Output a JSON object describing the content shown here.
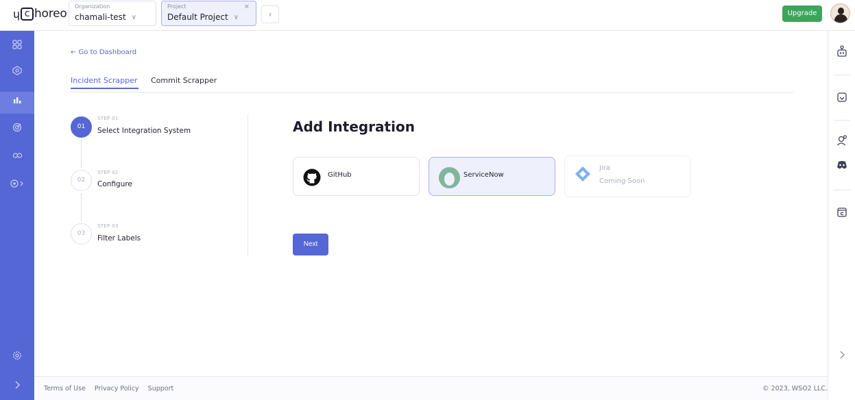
{
  "header": {
    "logo_prefix": "ɥ",
    "logo_c": "c",
    "logo_text": "horeo",
    "organization": {
      "label": "Organization",
      "value": "chamali-test"
    },
    "project": {
      "label": "Project",
      "value": "Default Project"
    },
    "upgrade_label": "Upgrade"
  },
  "sidebar": {
    "items": [
      {
        "icon": "grid-icon",
        "glyph": "⊞"
      },
      {
        "icon": "component-icon",
        "glyph": "⬡"
      },
      {
        "icon": "insights-icon",
        "glyph": "▮▮",
        "active": true
      },
      {
        "icon": "observability-icon",
        "glyph": "◎"
      },
      {
        "icon": "dependencies-icon",
        "glyph": "∞"
      },
      {
        "icon": "platform-icon",
        "glyph": "⊕›"
      },
      {
        "icon": "settings-icon",
        "glyph": "⚙"
      },
      {
        "icon": "expand-icon",
        "glyph": "›"
      }
    ]
  },
  "main": {
    "back_link": "← Go to Dashboard",
    "tabs": [
      {
        "label": "Incident Scrapper",
        "active": true
      },
      {
        "label": "Commit Scrapper",
        "active": false
      }
    ],
    "steps": [
      {
        "number": "01",
        "sub": "STEP 01",
        "title": "Select Integration System",
        "active": true
      },
      {
        "number": "02",
        "sub": "STEP 02",
        "title": "Configure",
        "active": false
      },
      {
        "number": "03",
        "sub": "STEP 03",
        "title": "Filter Labels",
        "active": false
      }
    ],
    "heading": "Add Integration",
    "integrations": [
      {
        "label": "GitHub",
        "icon": "github-icon",
        "state": "default"
      },
      {
        "label": "ServiceNow",
        "icon": "servicenow-icon",
        "state": "selected"
      },
      {
        "label": "Jira",
        "sublabel": "Coming Soon",
        "icon": "jira-icon",
        "state": "disabled"
      }
    ],
    "next_label": "Next"
  },
  "footer": {
    "links": [
      "Terms of Use",
      "Privacy Policy",
      "Support"
    ],
    "copyright": "© 2023, WSO2 LLC."
  },
  "colors": {
    "accent": "#5567d5",
    "upgrade": "#3fa45b",
    "selected_bg": "#eef0fb"
  }
}
